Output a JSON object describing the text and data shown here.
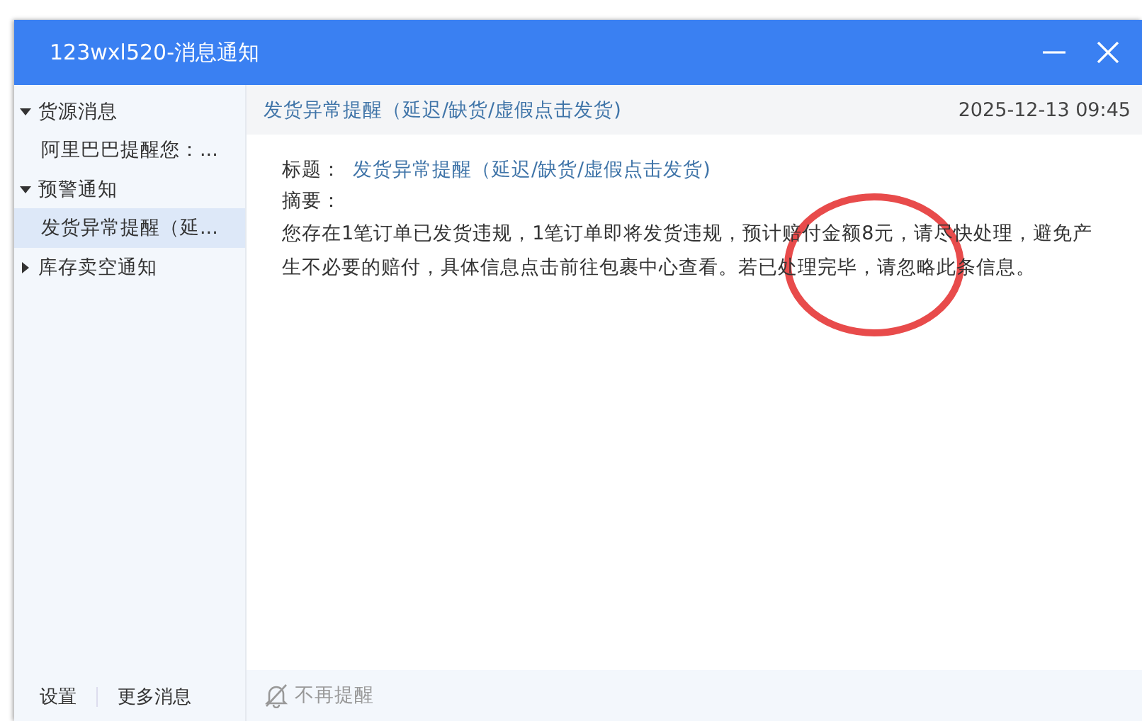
{
  "window": {
    "title": "123wxl520-消息通知"
  },
  "sidebar": {
    "groups": [
      {
        "label": "货源消息",
        "expanded": true,
        "items": [
          {
            "label": "阿里巴巴提醒您：...",
            "selected": false
          }
        ]
      },
      {
        "label": "预警通知",
        "expanded": true,
        "items": [
          {
            "label": "发货异常提醒（延...",
            "selected": true
          }
        ]
      },
      {
        "label": "库存卖空通知",
        "expanded": false
      }
    ],
    "footer": [
      "设置",
      "更多消息"
    ]
  },
  "message": {
    "header_title": "发货异常提醒（延迟/缺货/虚假点击发货)",
    "time": "2025-12-13 09:45",
    "title_label": "标题：",
    "title": "发货异常提醒（延迟/缺货/虚假点击发货)",
    "summary_label": "摘要：",
    "body": "您存在1笔订单已发货违规，1笔订单即将发货违规，预计赔付金额8元，请尽快处理，避免产生不必要的赔付，具体信息点击前往包裹中心查看。若已处理完毕，请忽略此条信息。"
  },
  "footer": {
    "mute_label": "不再提醒"
  }
}
